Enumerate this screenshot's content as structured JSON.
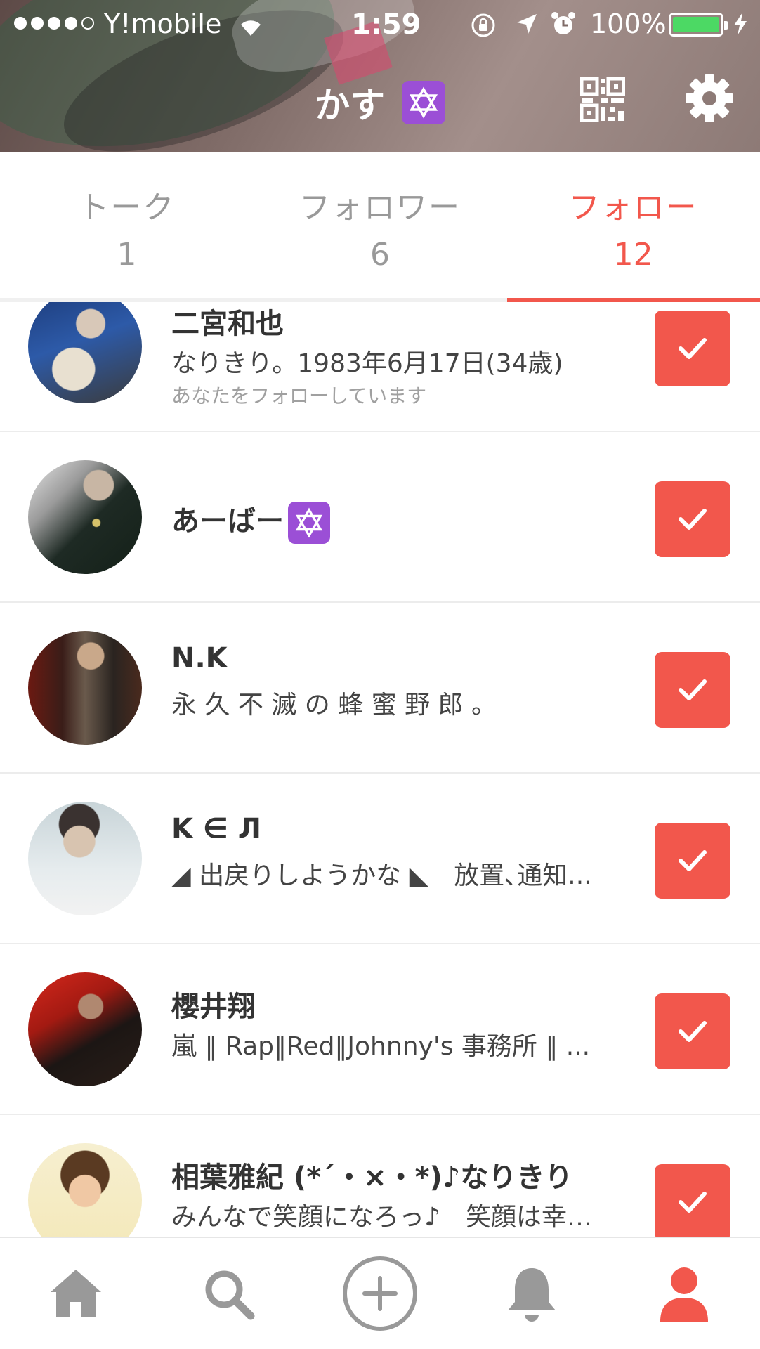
{
  "status_bar": {
    "carrier": "Y!mobile",
    "time": "1:59",
    "battery_percent": "100%",
    "signal_bars_filled": 4,
    "signal_bars_total": 5
  },
  "header": {
    "title": "かす",
    "title_badge_icon": "star-of-david-icon",
    "qr_icon": "qr-code-icon",
    "settings_icon": "gear-icon"
  },
  "tabs": [
    {
      "label": "トーク",
      "count": "1",
      "active": false
    },
    {
      "label": "フォロワー",
      "count": "6",
      "active": false
    },
    {
      "label": "フォロー",
      "count": "12",
      "active": true
    }
  ],
  "users": [
    {
      "name": "二宮和也",
      "bio": "なりきり。1983年6月17日(34歳)",
      "note": "あなたをフォローしています",
      "following": true
    },
    {
      "name": "あーばー",
      "bio": "",
      "note": "",
      "name_badge": "star-of-david-icon",
      "following": true
    },
    {
      "name": "N.K",
      "bio": "永 久 不 滅 の 蜂 蜜 野 郎 。",
      "note": "",
      "following": true
    },
    {
      "name": "K ∈ Л",
      "bio": "◢ 出戻りしようかな ◣　放置､通知...",
      "note": "",
      "following": true
    },
    {
      "name": "櫻井翔",
      "bio": "嵐 ‖ Rap‖Red‖Johnny's 事務所 ‖ ...",
      "note": "",
      "following": true
    },
    {
      "name": "相葉雅紀 (*´・×・*)♪なりきり",
      "bio": "みんなで笑顔になろっ♪　笑顔は幸…",
      "note": "",
      "following": true
    }
  ],
  "bottom_nav": [
    {
      "icon": "home-icon",
      "active": false
    },
    {
      "icon": "search-icon",
      "active": false
    },
    {
      "icon": "add-circle-icon",
      "active": false
    },
    {
      "icon": "bell-icon",
      "active": false
    },
    {
      "icon": "profile-icon",
      "active": true
    }
  ],
  "colors": {
    "accent": "#f2574c",
    "inactive": "#999999",
    "badge_purple": "#9b4fd6",
    "battery_green": "#4cd964"
  }
}
